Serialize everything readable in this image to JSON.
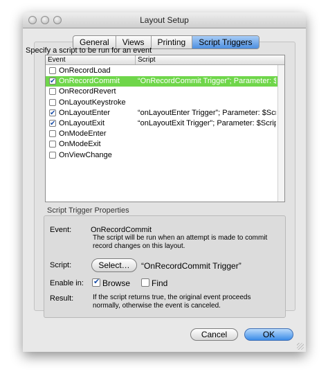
{
  "window": {
    "title": "Layout Setup"
  },
  "tabs": [
    {
      "label": "General"
    },
    {
      "label": "Views"
    },
    {
      "label": "Printing"
    },
    {
      "label": "Script Triggers",
      "active": true
    }
  ],
  "triggers": {
    "instruction": "Specify a script to be run for an event",
    "columns": {
      "event": "Event",
      "script": "Script"
    },
    "rows": [
      {
        "event": "OnRecordLoad",
        "checked": false,
        "script": ""
      },
      {
        "event": "OnRecordCommit",
        "checked": true,
        "script": "“OnRecordCommit Trigger”; Parameter: $ScriptTrigger",
        "selected": true
      },
      {
        "event": "OnRecordRevert",
        "checked": false,
        "script": ""
      },
      {
        "event": "OnLayoutKeystroke",
        "checked": false,
        "script": ""
      },
      {
        "event": "OnLayoutEnter",
        "checked": true,
        "script": "“onLayoutEnter Trigger”; Parameter: $ScriptTrigger"
      },
      {
        "event": "OnLayoutExit",
        "checked": true,
        "script": "“onLayoutExit Trigger”; Parameter: $ScriptTrigger"
      },
      {
        "event": "OnModeEnter",
        "checked": false,
        "script": ""
      },
      {
        "event": "OnModeExit",
        "checked": false,
        "script": ""
      },
      {
        "event": "OnViewChange",
        "checked": false,
        "script": ""
      }
    ]
  },
  "properties": {
    "section_label": "Script Trigger Properties",
    "event_label": "Event:",
    "event_value": "OnRecordCommit",
    "event_desc": "The script will be run when an attempt is made to commit record changes on this layout.",
    "script_label": "Script:",
    "select_button": "Select…",
    "script_value": "“OnRecordCommit Trigger”",
    "enable_label": "Enable in:",
    "browse_label": "Browse",
    "browse_checked": true,
    "find_label": "Find",
    "find_checked": false,
    "result_label": "Result:",
    "result_desc": "If the script returns true, the original event proceeds normally, otherwise the event is canceled."
  },
  "buttons": {
    "cancel": "Cancel",
    "ok": "OK"
  },
  "colors": {
    "selection": "#6fd64a",
    "active_tab": "#4d8fe0",
    "default_button": "#3b8ce8"
  }
}
